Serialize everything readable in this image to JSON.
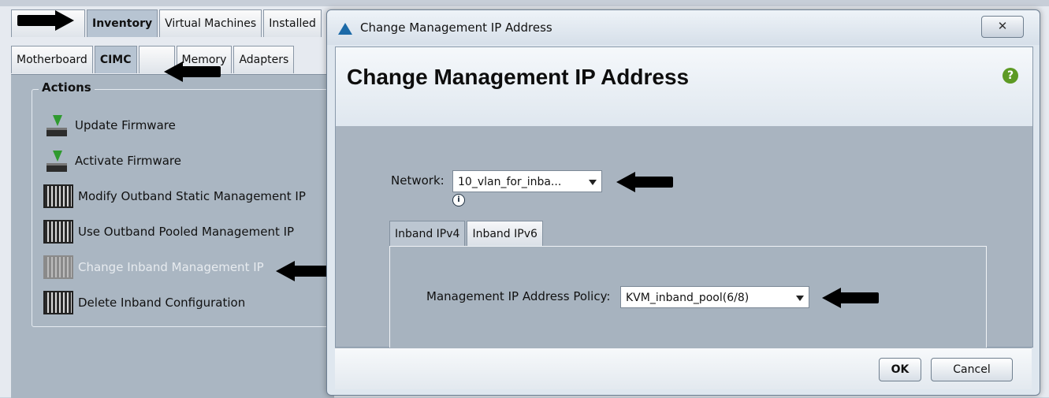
{
  "app": {
    "top_tabs": [
      "",
      "Inventory",
      "Virtual Machines",
      "Installed"
    ],
    "sub_tabs": [
      "Motherboard",
      "CIMC",
      "",
      "Memory",
      "Adapters"
    ],
    "actions": {
      "title": "Actions",
      "items": [
        {
          "label": "Update Firmware",
          "icon": "firmware-icon"
        },
        {
          "label": "Activate Firmware",
          "icon": "firmware-icon"
        },
        {
          "label": "Modify Outband Static Management IP",
          "icon": "server-icon"
        },
        {
          "label": "Use Outband Pooled Management IP",
          "icon": "server-icon"
        },
        {
          "label": "Change Inband Management IP",
          "icon": "server-icon",
          "disabled": true
        },
        {
          "label": "Delete Inband Configuration",
          "icon": "server-icon"
        }
      ]
    }
  },
  "dialog": {
    "window_title": "Change Management IP Address",
    "close_label": "✕",
    "heading": "Change Management IP Address",
    "help": "?",
    "network_label": "Network:",
    "network_value": "10_vlan_for_inba...",
    "info": "i",
    "tabs": [
      "Inband IPv4",
      "Inband IPv6"
    ],
    "policy_label": "Management IP Address Policy:",
    "policy_value": "KVM_inband_pool(6/8)",
    "ok_label": "OK",
    "cancel_label": "Cancel"
  },
  "colors": {
    "annotation_arrow": "#000000",
    "help_icon": "#5d9a24",
    "dialog_logo": "#1c6aa8"
  }
}
